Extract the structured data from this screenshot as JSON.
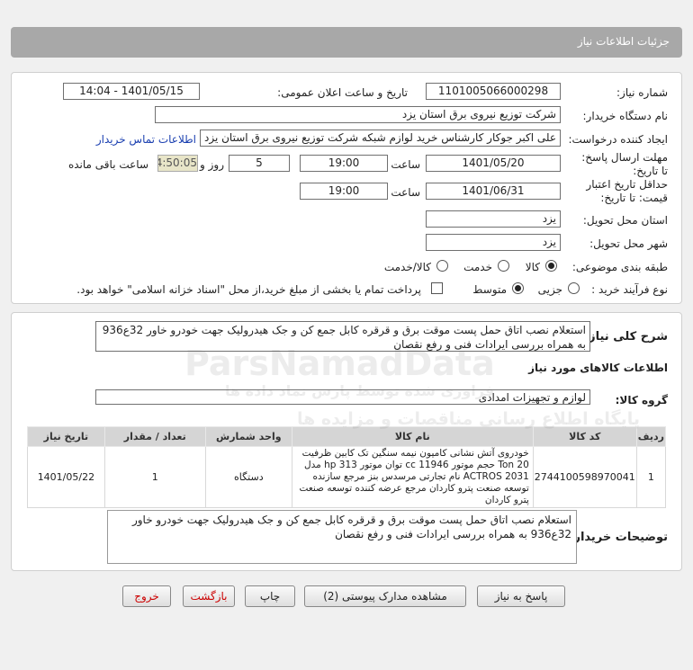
{
  "header": {
    "title": "جزئیات اطلاعات نیاز"
  },
  "form": {
    "need_number_label": "شماره نیاز:",
    "need_number": "1101005066000298",
    "announce_label": "تاریخ و ساعت اعلان عمومی:",
    "announce_value": "1401/05/15 - 14:04",
    "buyer_label": "نام دستگاه خریدار:",
    "buyer_value": "شرکت توزیع نیروی برق استان یزد",
    "creator_label": "ایجاد کننده درخواست:",
    "creator_value": "علی اکبر  جوکار  کارشناس خرید لوازم شبکه  شرکت توزیع نیروی برق استان یزد",
    "contact_link": "اطلاعات تماس خریدار",
    "deadline_label": "مهلت ارسال پاسخ: تا تاریخ:",
    "deadline_date": "1401/05/20",
    "time_label": "ساعت",
    "deadline_time": "19:00",
    "days_value": "5",
    "days_label": "روز و",
    "remaining_value": "04:50:05",
    "remaining_label": "ساعت باقی مانده",
    "validity_label": "حداقل تاریخ اعتبار قیمت: تا تاریخ:",
    "validity_date": "1401/06/31",
    "validity_time": "19:00",
    "province_label": "استان محل تحویل:",
    "province_value": "یزد",
    "city_label": "شهر محل تحویل:",
    "city_value": "یزد",
    "category_label": "طبقه بندی موضوعی:",
    "category_options": [
      "کالا",
      "خدمت",
      "کالا/خدمت"
    ],
    "purchase_type_label": "نوع فرآیند خرید :",
    "purchase_options": [
      "جزیی",
      "متوسط"
    ],
    "payment_note": "پرداخت تمام یا بخشی از مبلغ خرید،از محل \"اسناد خزانه اسلامی\" خواهد بود."
  },
  "summary": {
    "label": "شرح کلی نیاز:",
    "text": "استعلام نصب اتاق حمل پست موقت برق و قرقره کابل جمع کن و جک هیدرولیک جهت خودرو خاور 32ع936 به همراه بررسی ایرادات فنی و رفع نقصان"
  },
  "goods_info": {
    "title": "اطلاعات کالاهای مورد نیاز",
    "group_label": "گروه کالا:",
    "group_value": "لوازم و تجهیزات امدادی"
  },
  "table": {
    "headers": [
      "ردیف",
      "کد کالا",
      "نام کالا",
      "واحد شمارش",
      "تعداد / مقدار",
      "تاریخ نیاز"
    ],
    "rows": [
      {
        "row": "1",
        "code": "2744100598970041",
        "name": "خودروی آتش نشانی کامیون نیمه سنگین تک کابین ظرفیت 20 Ton حجم موتور cc 11946 توان موتور hp 313 مدل ACTROS 2031 نام تجارتی مرسدس بنز مرجع سازنده توسعه صنعت پترو کاردان مرجع عرضه کننده توسعه صنعت پترو کاردان",
        "unit": "دستگاه",
        "qty": "1",
        "date": "1401/05/22"
      }
    ]
  },
  "buyer_notes": {
    "label": "توضیحات خریدار:",
    "text": "استعلام نصب اتاق حمل پست موقت برق و قرقره کابل جمع کن و جک هیدرولیک جهت خودرو خاور 32ع936 به همراه بررسی ایرادات فنی و رفع نقصان"
  },
  "buttons": {
    "reply": "پاسخ به نیاز",
    "docs": "مشاهده مدارک پیوستی (2)",
    "print": "چاپ",
    "back": "بازگشت",
    "exit": "خروج"
  },
  "watermark": {
    "brand": "ParsNamadData",
    "line1": "پایگاه اطلاع رسانی مناقصات و مزایده ها",
    "line2": "فراوری شده توسط پارس نماد داده ها"
  }
}
